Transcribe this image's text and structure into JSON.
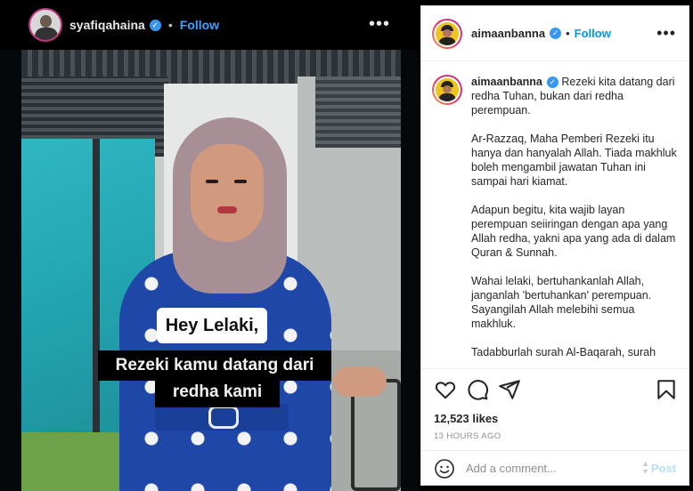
{
  "video": {
    "username": "syafiqahaina",
    "follow_label": "Follow",
    "more_label": "•••",
    "captions": [
      "Hey Lelaki,",
      "Rezeki kamu datang dari",
      "redha kami"
    ]
  },
  "post": {
    "username": "aimaanbanna",
    "follow_label": "Follow",
    "more_label": "•••",
    "caption_paragraphs": [
      "Rezeki kita datang dari redha Tuhan, bukan dari redha perempuan.",
      "Ar-Razzaq, Maha Pemberi Rezeki itu hanya dan hanyalah Allah. Tiada makhluk boleh mengambil jawatan Tuhan ini sampai hari kiamat.",
      "Adapun begitu, kita wajib layan perempuan seiiringan dengan apa yang Allah redha, yakni apa yang ada di dalam Quran & Sunnah.",
      "Wahai lelaki, bertuhankanlah Allah, janganlah 'bertuhankan' perempuan. Sayangilah Allah melebihi semua makhluk.",
      "Tadabburlah surah Al-Baqarah, surah"
    ],
    "likes": "12,523 likes",
    "timestamp": "13 HOURS AGO",
    "comment_placeholder": "Add a comment...",
    "post_label": "Post"
  },
  "colors": {
    "accent": "#0095f6",
    "verified": "#3897f0",
    "dress": "#1f47a8",
    "hijab": "#a88f95"
  },
  "icons": [
    "verified-badge-icon",
    "more-options-icon",
    "heart-icon",
    "comment-icon",
    "share-icon",
    "bookmark-icon",
    "emoji-icon"
  ]
}
